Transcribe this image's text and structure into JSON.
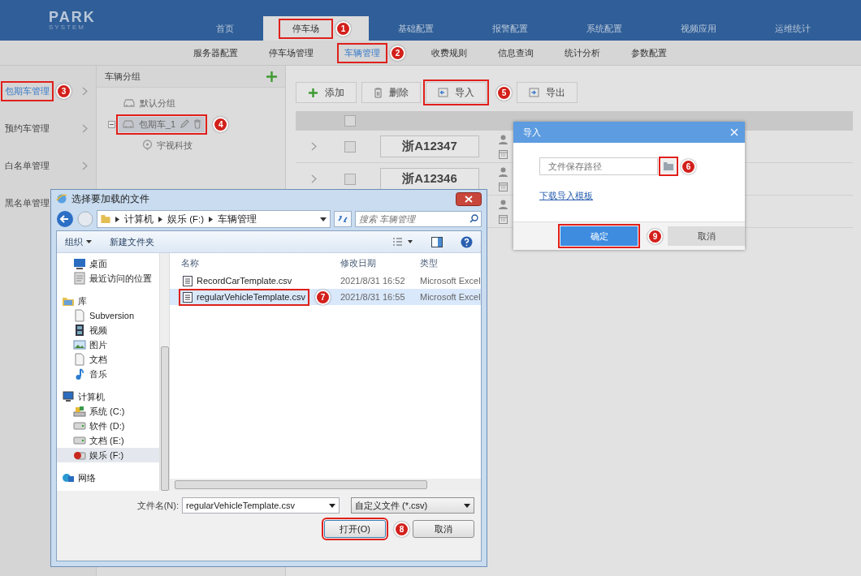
{
  "header": {
    "logo_title": "PARK",
    "logo_subtitle": "SYSTEM",
    "tabs": [
      {
        "label": "首页",
        "selected": false
      },
      {
        "label": "停车场",
        "selected": true,
        "step": "1"
      },
      {
        "label": "基础配置",
        "selected": false
      },
      {
        "label": "报警配置",
        "selected": false
      },
      {
        "label": "系统配置",
        "selected": false
      },
      {
        "label": "视频应用",
        "selected": false
      },
      {
        "label": "运维统计",
        "selected": false
      }
    ]
  },
  "subnav": [
    {
      "label": "服务器配置",
      "selected": false
    },
    {
      "label": "停车场管理",
      "selected": false
    },
    {
      "label": "车辆管理",
      "selected": true,
      "step": "2"
    },
    {
      "label": "收费规则",
      "selected": false
    },
    {
      "label": "信息查询",
      "selected": false
    },
    {
      "label": "统计分析",
      "selected": false
    },
    {
      "label": "参数配置",
      "selected": false
    }
  ],
  "sidebar": [
    {
      "label": "包期车管理",
      "selected": true,
      "step": "3"
    },
    {
      "label": "预约车管理",
      "selected": false
    },
    {
      "label": "白名单管理",
      "selected": false
    },
    {
      "label": "黑名单管理",
      "selected": false
    }
  ],
  "group_panel": {
    "title": "车辆分组",
    "tree": [
      {
        "label": "默认分组",
        "kind": "car",
        "selected": false
      },
      {
        "label": "包期车_1",
        "kind": "car",
        "selected": true,
        "step": "4",
        "expanded": true,
        "children": [
          {
            "label": "宇视科技",
            "kind": "pin",
            "selected": false
          }
        ]
      }
    ]
  },
  "toolbar": [
    {
      "label": "添加",
      "kind": "add"
    },
    {
      "label": "删除",
      "kind": "delete"
    },
    {
      "label": "导入",
      "kind": "import",
      "step": "5"
    },
    {
      "label": "导出",
      "kind": "export"
    }
  ],
  "table": {
    "header_checked": false,
    "rows": [
      {
        "plate": "浙A12347",
        "checked": false
      },
      {
        "plate": "浙A12346",
        "checked": false
      },
      {}
    ]
  },
  "import_dialog": {
    "title": "导入",
    "path_field": {
      "placeholder": "文件保存路径"
    },
    "browse_step": "6",
    "link": "下载导入模板",
    "buttons": [
      {
        "label": "确定",
        "kind": "primary",
        "step": "9"
      },
      {
        "label": "取消",
        "kind": "secondary"
      }
    ]
  },
  "file_dialog": {
    "title": "选择要加载的文件",
    "breadcrumb": [
      "计算机",
      "娱乐 (F:)",
      "车辆管理"
    ],
    "search": {
      "placeholder": "搜索 车辆管理"
    },
    "commands": [
      {
        "label": "组织",
        "kind": "menu"
      },
      {
        "label": "新建文件夹",
        "kind": "plain"
      }
    ],
    "nav": [
      {
        "children": [
          {
            "label": "桌面",
            "kind": "desktop",
            "selected": false
          },
          {
            "label": "最近访问的位置",
            "kind": "recent",
            "selected": false
          }
        ]
      },
      {
        "label": "库",
        "kind": "library",
        "selected": false,
        "children": [
          {
            "label": "Subversion",
            "kind": "doc",
            "selected": false
          },
          {
            "label": "视频",
            "kind": "video",
            "selected": false
          },
          {
            "label": "图片",
            "kind": "picture",
            "selected": false
          },
          {
            "label": "文档",
            "kind": "doc",
            "selected": false
          },
          {
            "label": "音乐",
            "kind": "music",
            "selected": false
          }
        ]
      },
      {
        "label": "计算机",
        "kind": "computer",
        "selected": false,
        "children": [
          {
            "label": "系统 (C:)",
            "kind": "sysdrive",
            "selected": false
          },
          {
            "label": "软件 (D:)",
            "kind": "drive",
            "selected": false
          },
          {
            "label": "文档 (E:)",
            "kind": "drive",
            "selected": false
          },
          {
            "label": "娱乐 (F:)",
            "kind": "appdrive",
            "selected": true
          }
        ]
      },
      {
        "label": "网络",
        "kind": "network",
        "selected": false
      }
    ],
    "columns": [
      "名称",
      "修改日期",
      "类型"
    ],
    "files": [
      {
        "name": "RecordCarTemplate.csv",
        "modified": "2021/8/31 16:52",
        "type": "Microsoft Excel",
        "selected": false
      },
      {
        "name": "regularVehicleTemplate.csv",
        "modified": "2021/8/31 16:55",
        "type": "Microsoft Excel",
        "selected": true,
        "step": "7"
      }
    ],
    "filename": {
      "label": "文件名(N):",
      "value": "regularVehicleTemplate.csv"
    },
    "filter": "自定义文件 (*.csv)",
    "buttons": [
      {
        "label": "打开(O)",
        "kind": "open",
        "step": "8"
      },
      {
        "label": "取消",
        "kind": "cancel"
      }
    ]
  }
}
